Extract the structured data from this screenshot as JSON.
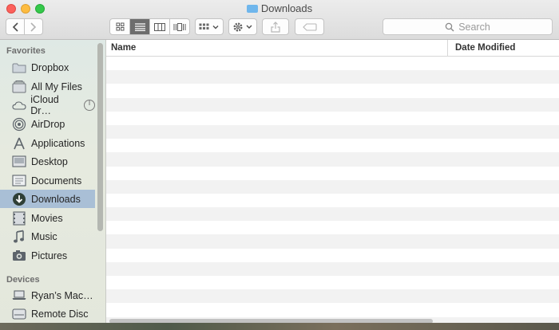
{
  "window": {
    "title": "Downloads"
  },
  "toolbar": {
    "back_icon": "chevron-left-icon",
    "forward_icon": "chevron-right-icon",
    "view_modes": [
      "icon-view",
      "list-view",
      "column-view",
      "cover-flow-view"
    ],
    "active_view": "list-view",
    "arrange_icon": "arrange-grid-icon",
    "action_icon": "gear-icon",
    "share_icon": "share-icon",
    "tags_icon": "tag-icon"
  },
  "search": {
    "placeholder": "Search"
  },
  "sidebar": {
    "favorites_header": "Favorites",
    "favorites": [
      {
        "label": "Dropbox",
        "icon": "dropbox-folder-icon"
      },
      {
        "label": "All My Files",
        "icon": "all-files-icon"
      },
      {
        "label": "iCloud Dr…",
        "icon": "icloud-icon"
      },
      {
        "label": "AirDrop",
        "icon": "airdrop-icon"
      },
      {
        "label": "Applications",
        "icon": "applications-icon"
      },
      {
        "label": "Desktop",
        "icon": "desktop-icon"
      },
      {
        "label": "Documents",
        "icon": "documents-icon"
      },
      {
        "label": "Downloads",
        "icon": "downloads-icon",
        "selected": true
      },
      {
        "label": "Movies",
        "icon": "movies-icon"
      },
      {
        "label": "Music",
        "icon": "music-icon"
      },
      {
        "label": "Pictures",
        "icon": "pictures-icon"
      }
    ],
    "devices_header": "Devices",
    "devices": [
      {
        "label": "Ryan’s Mac…",
        "icon": "laptop-icon"
      },
      {
        "label": "Remote Disc",
        "icon": "disc-icon"
      }
    ]
  },
  "list": {
    "columns": [
      "Name",
      "Date Modified"
    ],
    "rows": []
  },
  "colors": {
    "selection": "#a9bfd6",
    "active_segment": "#6d6d6d"
  }
}
